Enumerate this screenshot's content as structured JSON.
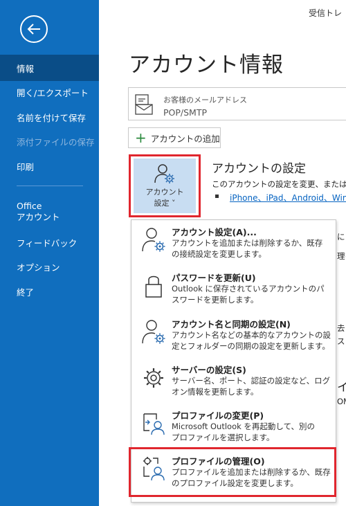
{
  "header": {
    "top_right": "受信トレ"
  },
  "sidebar": {
    "items": [
      {
        "label": "情報"
      },
      {
        "label": "開く/エクスポート"
      },
      {
        "label": "名前を付けて保存"
      },
      {
        "label": "添付ファイルの保存"
      },
      {
        "label": "印刷"
      },
      {
        "label_line1": "Office",
        "label_line2": "アカウント"
      },
      {
        "label": "フィードバック"
      },
      {
        "label": "オプション"
      },
      {
        "label": "終了"
      }
    ]
  },
  "main": {
    "title": "アカウント情報",
    "email": {
      "label": "お客様のメールアドレス",
      "type": "POP/SMTP"
    },
    "add_account": "アカウントの追加",
    "account_button": {
      "line1": "アカウント",
      "line2": "設定 ˅"
    },
    "settings": {
      "title": "アカウントの設定",
      "desc": "このアカウントの設定を変更、または追加",
      "link": "iPhone、iPad、Android、Wind"
    },
    "background_fragments": {
      "f1": "に",
      "f2": "理を",
      "f3": "去",
      "f4": "ス",
      "f5": "イ",
      "f6": "OM"
    }
  },
  "menu": {
    "items": [
      {
        "title": "アカウント設定(A)...",
        "desc1": "アカウントを追加または削除するか、既存",
        "desc2": "の接続設定を変更します。",
        "icon": "account-gear-icon"
      },
      {
        "title": "パスワードを更新(U)",
        "desc1": "Outlook に保存されているアカウントのパ",
        "desc2": "スワードを更新します。",
        "icon": "lock-icon"
      },
      {
        "title": "アカウント名と同期の設定(N)",
        "desc1": "アカウント名などの基本的なアカウントの設",
        "desc2": "定とフォルダーの同期の設定を更新します。",
        "icon": "account-gear-icon"
      },
      {
        "title": "サーバーの設定(S)",
        "desc1": "サーバー名、ポート、認証の設定など、ログ",
        "desc2": "オン情報を更新します。",
        "icon": "gear-icon"
      },
      {
        "title": "プロファイルの変更(P)",
        "desc1": "Microsoft Outlook を再起動して、別の",
        "desc2": "プロファイルを選択します。",
        "icon": "profile-switch-icon"
      },
      {
        "title": "プロファイルの管理(O)",
        "desc1": "プロファイルを追加または削除するか、既存",
        "desc2": "のプロファイル設定を変更します。",
        "icon": "profile-manage-icon"
      }
    ]
  },
  "colors": {
    "sidebar": "#106ebe",
    "sidebar_selected": "#0a4d87",
    "highlight": "#e0262e",
    "link": "#0563c1",
    "account_button_bg": "#c8ddf2"
  }
}
